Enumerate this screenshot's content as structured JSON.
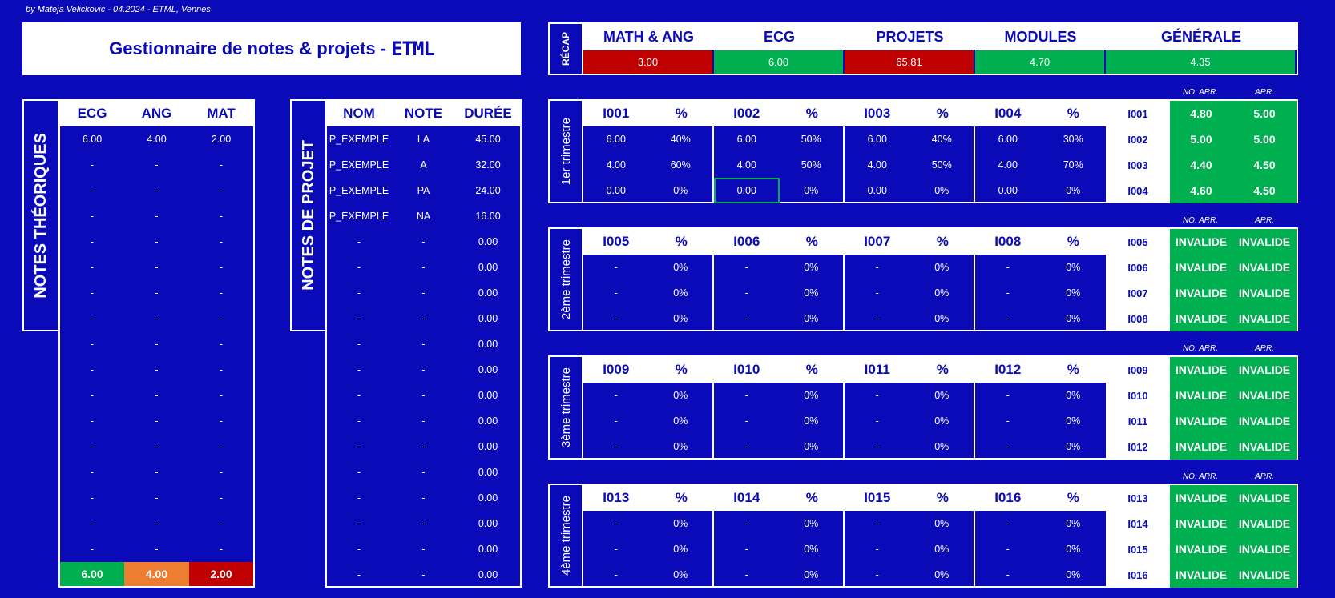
{
  "credit": "by Mateja Velickovic - 04.2024 - ETML, Vennes",
  "title": "Gestionnaire de notes & projets -",
  "logo": "ETML",
  "recap": {
    "label": "RÉCAP",
    "headers": [
      "MATH & ANG",
      "ECG",
      "PROJETS",
      "MODULES",
      "GÉNÉRALE"
    ],
    "values": [
      "3.00",
      "6.00",
      "65.81",
      "4.70",
      "4.35"
    ],
    "colors": [
      "#c00000",
      "#00b050",
      "#c00000",
      "#00b050",
      "#00b050"
    ]
  },
  "theory": {
    "label": "NOTES THÉORIQUES",
    "headers": [
      "ECG",
      "ANG",
      "MAT"
    ],
    "rows": [
      [
        "6.00",
        "4.00",
        "2.00"
      ],
      [
        "-",
        "-",
        "-"
      ],
      [
        "-",
        "-",
        "-"
      ],
      [
        "-",
        "-",
        "-"
      ],
      [
        "-",
        "-",
        "-"
      ],
      [
        "-",
        "-",
        "-"
      ],
      [
        "-",
        "-",
        "-"
      ],
      [
        "-",
        "-",
        "-"
      ],
      [
        "-",
        "-",
        "-"
      ],
      [
        "-",
        "-",
        "-"
      ],
      [
        "-",
        "-",
        "-"
      ],
      [
        "-",
        "-",
        "-"
      ],
      [
        "-",
        "-",
        "-"
      ],
      [
        "-",
        "-",
        "-"
      ],
      [
        "-",
        "-",
        "-"
      ],
      [
        "-",
        "-",
        "-"
      ],
      [
        "-",
        "-",
        "-"
      ]
    ],
    "totals": [
      "6.00",
      "4.00",
      "2.00"
    ],
    "total_colors": [
      "#00b050",
      "#ed7d31",
      "#c00000"
    ]
  },
  "projects": {
    "label": "NOTES DE PROJET",
    "headers": [
      "NOM",
      "NOTE",
      "DURÉE"
    ],
    "rows": [
      [
        "P_EXEMPLE",
        "LA",
        "45.00"
      ],
      [
        "P_EXEMPLE",
        "A",
        "32.00"
      ],
      [
        "P_EXEMPLE",
        "PA",
        "24.00"
      ],
      [
        "P_EXEMPLE",
        "NA",
        "16.00"
      ],
      [
        "-",
        "-",
        "0.00"
      ],
      [
        "-",
        "-",
        "0.00"
      ],
      [
        "-",
        "-",
        "0.00"
      ],
      [
        "-",
        "-",
        "0.00"
      ],
      [
        "-",
        "-",
        "0.00"
      ],
      [
        "-",
        "-",
        "0.00"
      ],
      [
        "-",
        "-",
        "0.00"
      ],
      [
        "-",
        "-",
        "0.00"
      ],
      [
        "-",
        "-",
        "0.00"
      ],
      [
        "-",
        "-",
        "0.00"
      ],
      [
        "-",
        "-",
        "0.00"
      ],
      [
        "-",
        "-",
        "0.00"
      ],
      [
        "-",
        "-",
        "0.00"
      ],
      [
        "-",
        "-",
        "0.00"
      ]
    ]
  },
  "arr_headers": [
    "NO. ARR.",
    "ARR."
  ],
  "trimesters": [
    {
      "label": "1er trimestre",
      "headers": [
        "I001",
        "%",
        "I002",
        "%",
        "I003",
        "%",
        "I004",
        "%"
      ],
      "rows": [
        [
          "6.00",
          "40%",
          "6.00",
          "50%",
          "6.00",
          "40%",
          "6.00",
          "30%"
        ],
        [
          "4.00",
          "60%",
          "4.00",
          "50%",
          "4.00",
          "50%",
          "4.00",
          "70%"
        ],
        [
          "0.00",
          "0%",
          "0.00",
          "0%",
          "0.00",
          "0%",
          "0.00",
          "0%"
        ]
      ],
      "summary": [
        [
          "I001",
          "4.80",
          "5.00"
        ],
        [
          "I002",
          "5.00",
          "5.00"
        ],
        [
          "I003",
          "4.40",
          "4.50"
        ],
        [
          "I004",
          "4.60",
          "4.50"
        ]
      ]
    },
    {
      "label": "2ème trimestre",
      "headers": [
        "I005",
        "%",
        "I006",
        "%",
        "I007",
        "%",
        "I008",
        "%"
      ],
      "rows": [
        [
          "-",
          "0%",
          "-",
          "0%",
          "-",
          "0%",
          "-",
          "0%"
        ],
        [
          "-",
          "0%",
          "-",
          "0%",
          "-",
          "0%",
          "-",
          "0%"
        ],
        [
          "-",
          "0%",
          "-",
          "0%",
          "-",
          "0%",
          "-",
          "0%"
        ]
      ],
      "summary": [
        [
          "I005",
          "INVALIDE",
          "INVALIDE"
        ],
        [
          "I006",
          "INVALIDE",
          "INVALIDE"
        ],
        [
          "I007",
          "INVALIDE",
          "INVALIDE"
        ],
        [
          "I008",
          "INVALIDE",
          "INVALIDE"
        ]
      ]
    },
    {
      "label": "3ème trimestre",
      "headers": [
        "I009",
        "%",
        "I010",
        "%",
        "I011",
        "%",
        "I012",
        "%"
      ],
      "rows": [
        [
          "-",
          "0%",
          "-",
          "0%",
          "-",
          "0%",
          "-",
          "0%"
        ],
        [
          "-",
          "0%",
          "-",
          "0%",
          "-",
          "0%",
          "-",
          "0%"
        ],
        [
          "-",
          "0%",
          "-",
          "0%",
          "-",
          "0%",
          "-",
          "0%"
        ]
      ],
      "summary": [
        [
          "I009",
          "INVALIDE",
          "INVALIDE"
        ],
        [
          "I010",
          "INVALIDE",
          "INVALIDE"
        ],
        [
          "I011",
          "INVALIDE",
          "INVALIDE"
        ],
        [
          "I012",
          "INVALIDE",
          "INVALIDE"
        ]
      ]
    },
    {
      "label": "4ème trimestre",
      "headers": [
        "I013",
        "%",
        "I014",
        "%",
        "I015",
        "%",
        "I016",
        "%"
      ],
      "rows": [
        [
          "-",
          "0%",
          "-",
          "0%",
          "-",
          "0%",
          "-",
          "0%"
        ],
        [
          "-",
          "0%",
          "-",
          "0%",
          "-",
          "0%",
          "-",
          "0%"
        ],
        [
          "-",
          "0%",
          "-",
          "0%",
          "-",
          "0%",
          "-",
          "0%"
        ]
      ],
      "summary": [
        [
          "I013",
          "INVALIDE",
          "INVALIDE"
        ],
        [
          "I014",
          "INVALIDE",
          "INVALIDE"
        ],
        [
          "I015",
          "INVALIDE",
          "INVALIDE"
        ],
        [
          "I016",
          "INVALIDE",
          "INVALIDE"
        ]
      ]
    }
  ]
}
